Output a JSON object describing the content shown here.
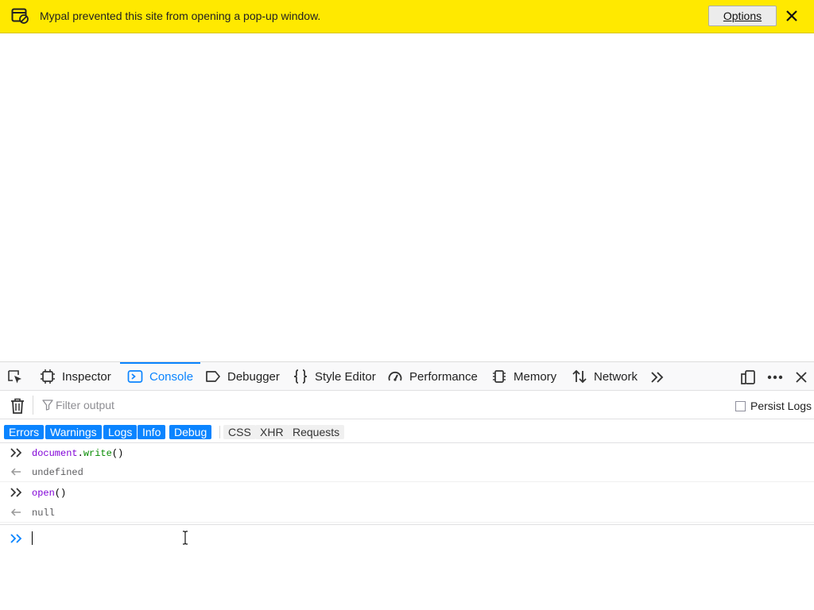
{
  "notification": {
    "message": "Mypal prevented this site from opening a pop-up window.",
    "options_label": "Options",
    "background": "#ffe900"
  },
  "devtools": {
    "tabs": [
      {
        "label": "Inspector",
        "icon": "inspector-icon"
      },
      {
        "label": "Console",
        "icon": "console-icon",
        "active": true
      },
      {
        "label": "Debugger",
        "icon": "debugger-icon"
      },
      {
        "label": "Style Editor",
        "icon": "style-editor-icon"
      },
      {
        "label": "Performance",
        "icon": "performance-icon"
      },
      {
        "label": "Memory",
        "icon": "memory-icon"
      },
      {
        "label": "Network",
        "icon": "network-icon"
      }
    ],
    "accent": "#0a84ff",
    "filter_placeholder": "Filter output",
    "persist_logs_label": "Persist Logs",
    "persist_logs_checked": false,
    "levels": [
      {
        "label": "Errors",
        "active": true
      },
      {
        "label": "Warnings",
        "active": true
      },
      {
        "label": "Logs",
        "active": true
      },
      {
        "label": "Info",
        "active": true
      },
      {
        "label": "Debug",
        "active": true
      }
    ],
    "categories": [
      {
        "label": "CSS",
        "active": false
      },
      {
        "label": "XHR",
        "active": false
      },
      {
        "label": "Requests",
        "active": false
      }
    ],
    "output": [
      {
        "type": "command",
        "object": "document",
        "method": "write",
        "args": "()"
      },
      {
        "type": "result",
        "text": "undefined"
      },
      {
        "type": "command",
        "object": "",
        "method": "open",
        "args": "()"
      },
      {
        "type": "result",
        "text": "null"
      }
    ],
    "input_value": ""
  }
}
